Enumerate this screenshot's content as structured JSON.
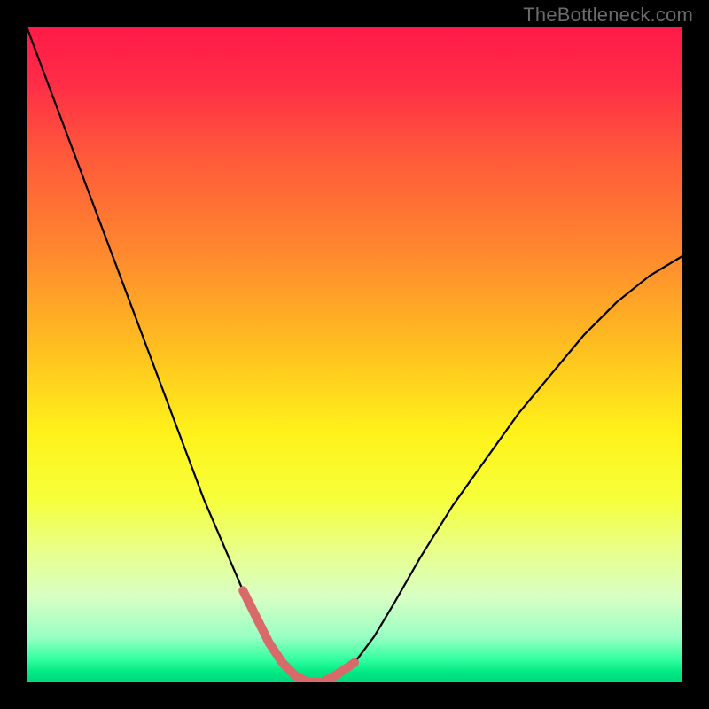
{
  "watermark": "TheBottleneck.com",
  "chart_data": {
    "type": "line",
    "title": "",
    "xlabel": "",
    "ylabel": "",
    "xlim": [
      0,
      100
    ],
    "ylim": [
      0,
      100
    ],
    "background_gradient": {
      "stops": [
        {
          "offset": 0.0,
          "color": "#ff1a47"
        },
        {
          "offset": 0.08,
          "color": "#ff2b47"
        },
        {
          "offset": 0.2,
          "color": "#ff5a3a"
        },
        {
          "offset": 0.35,
          "color": "#ff8a2e"
        },
        {
          "offset": 0.5,
          "color": "#ffc31f"
        },
        {
          "offset": 0.62,
          "color": "#fff21a"
        },
        {
          "offset": 0.72,
          "color": "#f6ff3a"
        },
        {
          "offset": 0.8,
          "color": "#e8ff8c"
        },
        {
          "offset": 0.87,
          "color": "#d8ffc4"
        },
        {
          "offset": 0.93,
          "color": "#9affc4"
        },
        {
          "offset": 0.965,
          "color": "#32ffa0"
        },
        {
          "offset": 0.985,
          "color": "#00e884"
        },
        {
          "offset": 1.0,
          "color": "#00d878"
        }
      ]
    },
    "series": [
      {
        "name": "curve",
        "color": "#000000",
        "width": 2.2,
        "x": [
          0,
          3,
          6,
          9,
          12,
          15,
          18,
          21,
          24,
          27,
          30,
          33,
          35,
          37,
          39,
          41,
          43,
          45,
          47,
          50,
          53,
          56,
          60,
          65,
          70,
          75,
          80,
          85,
          90,
          95,
          100
        ],
        "values": [
          100,
          92,
          84,
          76,
          68,
          60,
          52,
          44,
          36,
          28,
          21,
          14,
          10,
          6,
          3,
          1,
          0,
          0,
          1,
          3,
          7,
          12,
          19,
          27,
          34,
          41,
          47,
          53,
          58,
          62,
          65
        ]
      },
      {
        "name": "highlight",
        "color": "#d86a6a",
        "width": 10,
        "linecap": "round",
        "x": [
          33,
          35,
          37,
          39,
          41,
          43,
          45,
          47,
          50
        ],
        "values": [
          14,
          10,
          6,
          3,
          1,
          0,
          0,
          1,
          3
        ]
      }
    ]
  }
}
